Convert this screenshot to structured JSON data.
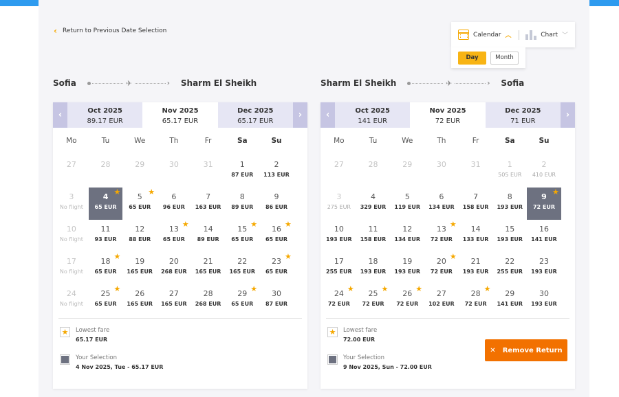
{
  "back_link": "Return to Previous Date Selection",
  "view": {
    "calendar_label": "Calendar",
    "chart_label": "Chart",
    "day_label": "Day",
    "month_label": "Month"
  },
  "weekdays": [
    "Mo",
    "Tu",
    "We",
    "Th",
    "Fr",
    "Sa",
    "Su"
  ],
  "outbound": {
    "from": "Sofia",
    "to": "Sharm El Sheikh",
    "months": [
      {
        "name": "Oct 2025",
        "price": "89.17 EUR"
      },
      {
        "name": "Nov 2025",
        "price": "65.17 EUR"
      },
      {
        "name": "Dec 2025",
        "price": "65.17 EUR"
      }
    ],
    "days": [
      {
        "d": "27",
        "p": "",
        "s": "muted"
      },
      {
        "d": "28",
        "p": "",
        "s": "muted"
      },
      {
        "d": "29",
        "p": "",
        "s": "muted"
      },
      {
        "d": "30",
        "p": "",
        "s": "muted"
      },
      {
        "d": "31",
        "p": "",
        "s": "muted"
      },
      {
        "d": "1",
        "p": "87 EUR"
      },
      {
        "d": "2",
        "p": "113 EUR"
      },
      {
        "d": "3",
        "p": "No flight",
        "s": "noflight"
      },
      {
        "d": "4",
        "p": "65 EUR",
        "s": "sel",
        "star": true
      },
      {
        "d": "5",
        "p": "65 EUR",
        "star": true
      },
      {
        "d": "6",
        "p": "96 EUR"
      },
      {
        "d": "7",
        "p": "163 EUR"
      },
      {
        "d": "8",
        "p": "89 EUR"
      },
      {
        "d": "9",
        "p": "86 EUR"
      },
      {
        "d": "10",
        "p": "No flight",
        "s": "noflight"
      },
      {
        "d": "11",
        "p": "93 EUR"
      },
      {
        "d": "12",
        "p": "88 EUR"
      },
      {
        "d": "13",
        "p": "65 EUR",
        "star": true
      },
      {
        "d": "14",
        "p": "89 EUR"
      },
      {
        "d": "15",
        "p": "65 EUR",
        "star": true
      },
      {
        "d": "16",
        "p": "65 EUR",
        "star": true
      },
      {
        "d": "17",
        "p": "No flight",
        "s": "noflight"
      },
      {
        "d": "18",
        "p": "65 EUR",
        "star": true
      },
      {
        "d": "19",
        "p": "165 EUR"
      },
      {
        "d": "20",
        "p": "268 EUR"
      },
      {
        "d": "21",
        "p": "165 EUR"
      },
      {
        "d": "22",
        "p": "165 EUR"
      },
      {
        "d": "23",
        "p": "65 EUR",
        "star": true
      },
      {
        "d": "24",
        "p": "No flight",
        "s": "noflight"
      },
      {
        "d": "25",
        "p": "65 EUR",
        "star": true
      },
      {
        "d": "26",
        "p": "165 EUR"
      },
      {
        "d": "27",
        "p": "165 EUR"
      },
      {
        "d": "28",
        "p": "268 EUR"
      },
      {
        "d": "29",
        "p": "65 EUR",
        "star": true
      },
      {
        "d": "30",
        "p": "87 EUR"
      }
    ],
    "legend": {
      "lowest_label": "Lowest fare",
      "lowest_value": "65.17 EUR",
      "selection_label": "Your Selection",
      "selection_value": "4 Nov 2025, Tue - 65.17 EUR"
    }
  },
  "return": {
    "from": "Sharm El Sheikh",
    "to": "Sofia",
    "months": [
      {
        "name": "Oct 2025",
        "price": "141 EUR"
      },
      {
        "name": "Nov 2025",
        "price": "72 EUR"
      },
      {
        "name": "Dec 2025",
        "price": "71 EUR"
      }
    ],
    "days": [
      {
        "d": "27",
        "p": "",
        "s": "muted"
      },
      {
        "d": "28",
        "p": "",
        "s": "muted"
      },
      {
        "d": "29",
        "p": "",
        "s": "muted"
      },
      {
        "d": "30",
        "p": "",
        "s": "muted"
      },
      {
        "d": "31",
        "p": "",
        "s": "muted"
      },
      {
        "d": "1",
        "p": "505 EUR",
        "s": "muted"
      },
      {
        "d": "2",
        "p": "410 EUR",
        "s": "muted"
      },
      {
        "d": "3",
        "p": "275 EUR",
        "s": "muted"
      },
      {
        "d": "4",
        "p": "329 EUR"
      },
      {
        "d": "5",
        "p": "119 EUR"
      },
      {
        "d": "6",
        "p": "134 EUR"
      },
      {
        "d": "7",
        "p": "158 EUR"
      },
      {
        "d": "8",
        "p": "193 EUR"
      },
      {
        "d": "9",
        "p": "72 EUR",
        "s": "sel",
        "star": true
      },
      {
        "d": "10",
        "p": "193 EUR"
      },
      {
        "d": "11",
        "p": "158 EUR"
      },
      {
        "d": "12",
        "p": "134 EUR"
      },
      {
        "d": "13",
        "p": "72 EUR",
        "star": true
      },
      {
        "d": "14",
        "p": "133 EUR"
      },
      {
        "d": "15",
        "p": "193 EUR"
      },
      {
        "d": "16",
        "p": "141 EUR"
      },
      {
        "d": "17",
        "p": "255 EUR"
      },
      {
        "d": "18",
        "p": "193 EUR"
      },
      {
        "d": "19",
        "p": "193 EUR"
      },
      {
        "d": "20",
        "p": "72 EUR",
        "star": true
      },
      {
        "d": "21",
        "p": "193 EUR"
      },
      {
        "d": "22",
        "p": "255 EUR"
      },
      {
        "d": "23",
        "p": "193 EUR"
      },
      {
        "d": "24",
        "p": "72 EUR",
        "star": true
      },
      {
        "d": "25",
        "p": "72 EUR",
        "star": true
      },
      {
        "d": "26",
        "p": "72 EUR",
        "star": true
      },
      {
        "d": "27",
        "p": "102 EUR"
      },
      {
        "d": "28",
        "p": "72 EUR",
        "star": true
      },
      {
        "d": "29",
        "p": "141 EUR"
      },
      {
        "d": "30",
        "p": "193 EUR"
      }
    ],
    "legend": {
      "lowest_label": "Lowest fare",
      "lowest_value": "72.00 EUR",
      "selection_label": "Your Selection",
      "selection_value": "9 Nov 2025, Sun - 72.00 EUR"
    },
    "remove_label": "Remove Return"
  },
  "colors": {
    "accent": "#f5a800",
    "selected": "#6d7180",
    "remove": "#f27100",
    "nav": "#c6c5e3"
  }
}
